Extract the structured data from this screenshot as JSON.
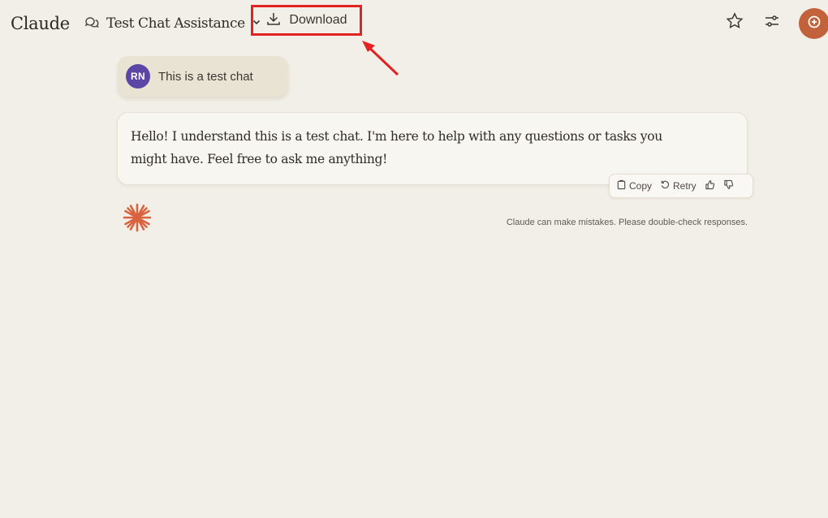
{
  "header": {
    "app_name": "Claude",
    "chat_title": "Test Chat Assistance",
    "download_label": "Download"
  },
  "conversation": {
    "user": {
      "initials": "RN",
      "message": "This is a test chat"
    },
    "assistant": {
      "message_line1": "Hello! I understand this is a test chat. I'm here to help with any questions or tasks you",
      "message_line2": "might have. Feel free to ask me anything!"
    },
    "actions": {
      "copy_label": "Copy",
      "retry_label": "Retry"
    },
    "disclaimer": "Claude can make mistakes. Please double-check responses."
  },
  "icons": [
    "chat-bubbles-icon",
    "chevron-down-icon",
    "download-icon",
    "star-icon",
    "sliders-icon",
    "new-chat-icon",
    "clipboard-icon",
    "retry-icon",
    "thumbs-up-icon",
    "thumbs-down-icon",
    "claude-spark-icon"
  ],
  "colors": {
    "background": "#f2efe8",
    "annotation_red": "#e32222",
    "user_avatar": "#5b46a6",
    "brand_orange": "#c2623b",
    "spark": "#d8633e"
  }
}
